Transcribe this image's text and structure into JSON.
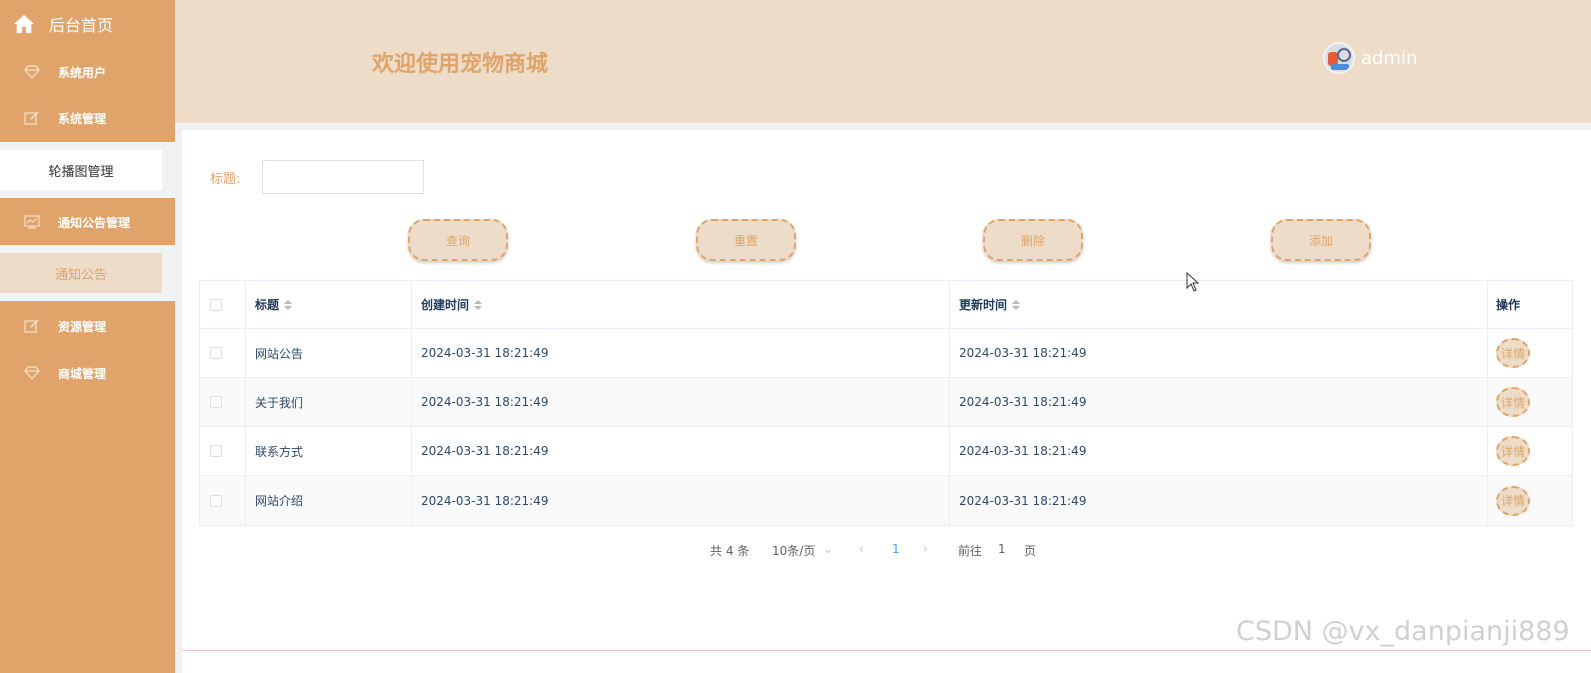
{
  "sidebar": {
    "home_label": "后台首页",
    "items": [
      {
        "label": "系统用户",
        "icon": "diamond-icon"
      },
      {
        "label": "系统管理",
        "icon": "edit-icon"
      },
      {
        "label": "通知公告管理",
        "icon": "chart-icon"
      },
      {
        "label": "资源管理",
        "icon": "edit-icon"
      },
      {
        "label": "商城管理",
        "icon": "diamond-icon"
      }
    ],
    "sub_items": {
      "carousel": "轮播图管理",
      "notice": "通知公告"
    }
  },
  "header": {
    "title": "欢迎使用宠物商城",
    "username": "admin"
  },
  "search": {
    "label": "标题:",
    "placeholder": "",
    "value": ""
  },
  "actions": {
    "query": "查询",
    "reset": "重置",
    "delete": "删除",
    "add": "添加"
  },
  "table": {
    "columns": [
      "标题",
      "创建时间",
      "更新时间",
      "操作"
    ],
    "rows": [
      {
        "title": "网站公告",
        "created": "2024-03-31 18:21:49",
        "updated": "2024-03-31 18:21:49",
        "action": "详情"
      },
      {
        "title": "关于我们",
        "created": "2024-03-31 18:21:49",
        "updated": "2024-03-31 18:21:49",
        "action": "详情"
      },
      {
        "title": "联系方式",
        "created": "2024-03-31 18:21:49",
        "updated": "2024-03-31 18:21:49",
        "action": "详情"
      },
      {
        "title": "网站介绍",
        "created": "2024-03-31 18:21:49",
        "updated": "2024-03-31 18:21:49",
        "action": "详情"
      }
    ]
  },
  "pagination": {
    "total": "共 4 条",
    "page_size": "10条/页",
    "current_page": "1",
    "goto_label": "前往",
    "goto_value": "1",
    "page_suffix": "页"
  },
  "watermark": "CSDN @vx_danpianji889",
  "colors": {
    "accent": "#e0a46a",
    "header_bg": "#ecdcc8",
    "link": "#409eff"
  }
}
